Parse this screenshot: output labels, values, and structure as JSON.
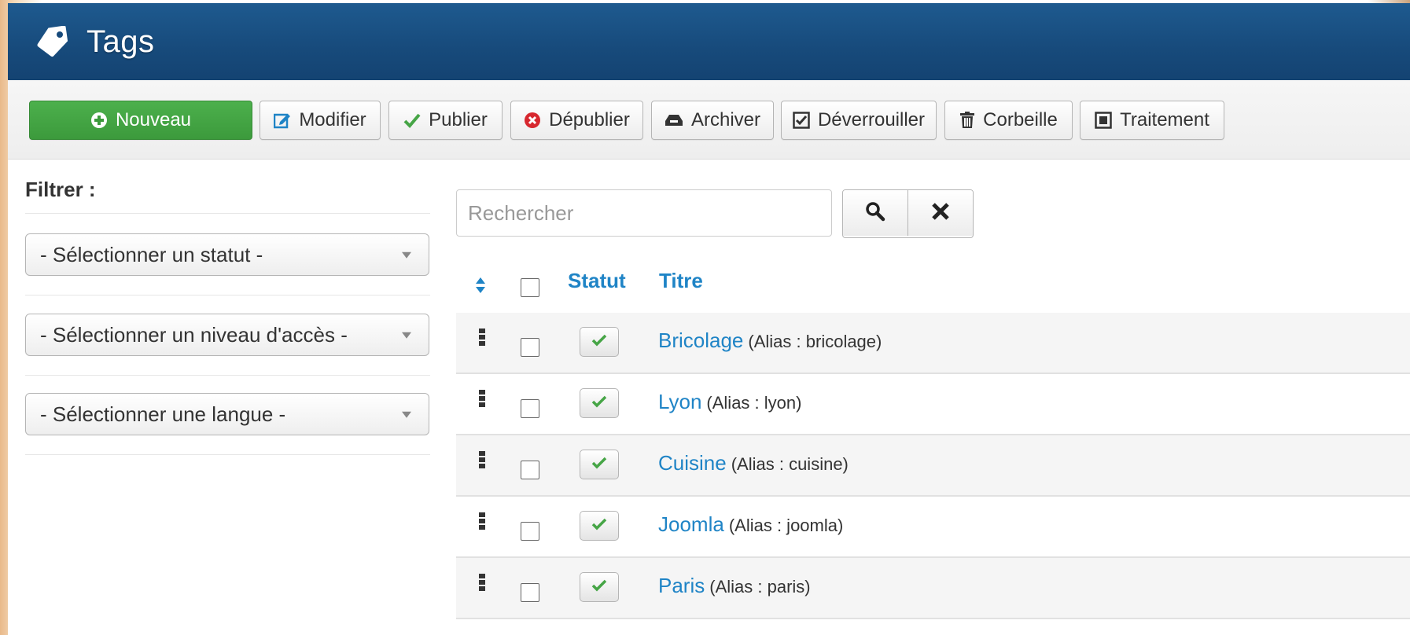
{
  "header": {
    "title": "Tags",
    "icon": "tag-icon"
  },
  "toolbar": {
    "new_label": "Nouveau",
    "edit_label": "Modifier",
    "publish_label": "Publier",
    "unpublish_label": "Dépublier",
    "archive_label": "Archiver",
    "checkin_label": "Déverrouiller",
    "trash_label": "Corbeille",
    "batch_label": "Traitement"
  },
  "sidebar": {
    "filter_label": "Filtrer :",
    "status_select": "- Sélectionner un statut -",
    "access_select": "- Sélectionner un niveau d'accès -",
    "language_select": "- Sélectionner une langue -"
  },
  "search": {
    "placeholder": "Rechercher"
  },
  "table": {
    "headers": {
      "status": "Statut",
      "title": "Titre"
    },
    "rows": [
      {
        "title": "Bricolage",
        "alias": "(Alias : bricolage)",
        "published": true
      },
      {
        "title": "Lyon",
        "alias": "(Alias : lyon)",
        "published": true
      },
      {
        "title": "Cuisine",
        "alias": "(Alias : cuisine)",
        "published": true
      },
      {
        "title": "Joomla",
        "alias": "(Alias : joomla)",
        "published": true
      },
      {
        "title": "Paris",
        "alias": "(Alias : paris)",
        "published": true
      }
    ]
  },
  "colors": {
    "header": "#174a7b",
    "primary": "#43a543",
    "link": "#1f84c6",
    "success": "#46a546",
    "danger": "#d7282f"
  }
}
